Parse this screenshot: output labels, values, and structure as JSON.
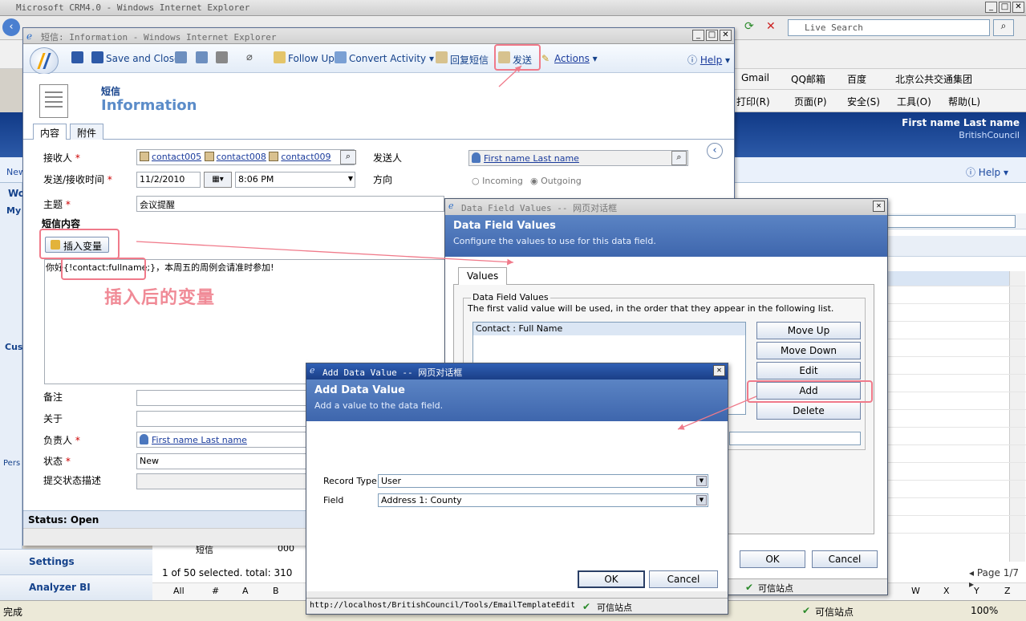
{
  "bg_window": {
    "title": "Microsoft CRM4.0 - Windows Internet Explorer",
    "search_placeholder": "Live Search",
    "favorites": [
      "Gmail",
      "QQ邮箱",
      "百度",
      "北京公共交通集团"
    ],
    "commands": [
      "打印(R)",
      "页面(P)",
      "安全(S)",
      "工具(O)",
      "帮助(L)"
    ],
    "user_name": "First name Last name",
    "org_name": "BritishCouncil",
    "help_label": "Help",
    "nav_settings": "Settings",
    "nav_analyzer": "Analyzer BI",
    "grid_status": "1 of 50 selected. total: 310",
    "page_indicator": "Page 1/7",
    "alpha_letters": [
      "All",
      "#",
      "A",
      "B",
      "W",
      "X",
      "Y",
      "Z"
    ],
    "status_left": "完成",
    "trusted_site": "可信站点",
    "zoom": "100%",
    "left_stubs": [
      "New",
      "Wo",
      "My",
      "Cus",
      "Pers"
    ],
    "grid_row_label": "短信",
    "grid_row_value": "000"
  },
  "main_window": {
    "title": "短信: Information - Windows Internet Explorer",
    "toolbar": {
      "save_close": "Save and Close",
      "follow_up": "Follow Up",
      "convert": "Convert Activity",
      "reply_sms": "回复短信",
      "send": "发送",
      "actions": "Actions",
      "help": "Help"
    },
    "entity": "短信",
    "record_name": "Information",
    "tabs": [
      "内容",
      "附件"
    ],
    "fields": {
      "recipient_label": "接收人",
      "recipients": [
        "contact005",
        "contact008",
        "contact009"
      ],
      "sender_label": "发送人",
      "sender": "First name Last name",
      "time_label": "发送/接收时间",
      "date": "11/2/2010",
      "time": "8:06 PM",
      "direction_label": "方向",
      "incoming": "Incoming",
      "outgoing": "Outgoing",
      "subject_label": "主题",
      "subject": "会议提醒",
      "content_label": "短信内容",
      "insert_var": "插入变量",
      "message": "你好{!contact:fullname;}，本周五的周例会请准时参加!",
      "remark_label": "备注",
      "regarding_label": "关于",
      "owner_label": "负责人",
      "owner": "First name Last name",
      "status_label": "状态",
      "status": "New",
      "submit_desc_label": "提交状态描述"
    },
    "annotation": "插入后的变量",
    "status_bar": "Status: Open"
  },
  "data_field_dialog": {
    "title": "Data Field Values -- 网页对话框",
    "heading": "Data Field Values",
    "subheading": "Configure the values to use for this data field.",
    "tab": "Values",
    "group_label": "Data Field Values",
    "hint": "The first valid value will be used, in the order that they appear in the following list.",
    "list_items": [
      "Contact : Full Name"
    ],
    "buttons": {
      "move_up": "Move Up",
      "move_down": "Move Down",
      "edit": "Edit",
      "add": "Add",
      "delete": "Delete"
    },
    "ok": "OK",
    "cancel": "Cancel",
    "trusted_site": "可信站点"
  },
  "add_value_dialog": {
    "title": "Add Data Value -- 网页对话框",
    "heading": "Add Data Value",
    "subheading": "Add a value to the data field.",
    "record_type_label": "Record Type",
    "record_type": "User",
    "field_label": "Field",
    "field": "Address 1: County",
    "ok": "OK",
    "cancel": "Cancel",
    "url": "http://localhost/BritishCouncil/Tools/EmailTemplateEdit",
    "trusted_site": "可信站点"
  },
  "colors": {
    "crm_header": "#113a87",
    "highlight": "#f07a8a",
    "banner": "#4a72b6"
  }
}
